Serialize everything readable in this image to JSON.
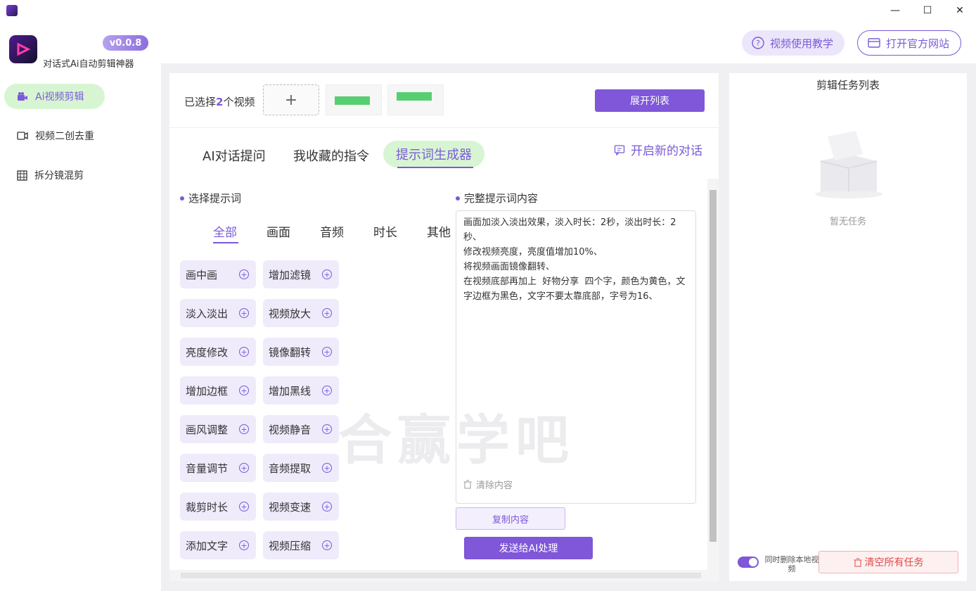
{
  "app": {
    "version": "v0.0.8",
    "name": "对话式Ai自动剪辑神器"
  },
  "window": {
    "minimize": "—",
    "maximize": "☐",
    "close": "✕"
  },
  "sidebar": {
    "items": [
      {
        "label": "Ai视频剪辑",
        "icon": "video-camera-icon",
        "active": true
      },
      {
        "label": "视频二创去重",
        "icon": "video-icon",
        "active": false
      },
      {
        "label": "拆分镜混剪",
        "icon": "grid-film-icon",
        "active": false
      }
    ]
  },
  "header": {
    "tutorial_label": "视频使用教学",
    "website_label": "打开官方网站"
  },
  "selection": {
    "prefix": "已选择",
    "count": "2",
    "suffix": "个视频",
    "add_symbol": "+",
    "expand_label": "展开列表"
  },
  "tabs": [
    {
      "label": "AI对话提问",
      "active": false
    },
    {
      "label": "我收藏的指令",
      "active": false
    },
    {
      "label": "提示词生成器",
      "active": true
    }
  ],
  "new_chat_label": "开启新的对话",
  "choose_prompt": {
    "title": "选择提示词",
    "categories": [
      "全部",
      "画面",
      "音频",
      "时长",
      "其他"
    ],
    "chips": [
      "画中画",
      "增加滤镜",
      "淡入淡出",
      "视频放大",
      "亮度修改",
      "镜像翻转",
      "增加边框",
      "增加黑线",
      "画风调整",
      "视频静音",
      "音量调节",
      "音频提取",
      "裁剪时长",
      "视频变速",
      "添加文字",
      "视频压缩"
    ]
  },
  "full_prompt": {
    "title": "完整提示词内容",
    "content": "画面加淡入淡出效果，淡入时长：2秒，淡出时长：2秒、\n修改视频亮度，亮度值增加10%、\n将视频画面镜像翻转、\n在视频底部再加上  好物分享  四个字，颜色为黄色，文字边框为黑色，文字不要太靠底部，字号为16、",
    "clear_label": "清除内容",
    "copy_label": "复制内容",
    "send_label": "发送给AI处理"
  },
  "watermark": "合赢学吧",
  "task_panel": {
    "title": "剪辑任务列表",
    "empty_text": "暂无任务",
    "toggle_label": "同时删除本地视频",
    "clear_all_label": "清空所有任务"
  },
  "colors": {
    "accent": "#7f57d8",
    "active_bg": "#d8f5d3",
    "danger": "#e04848"
  }
}
